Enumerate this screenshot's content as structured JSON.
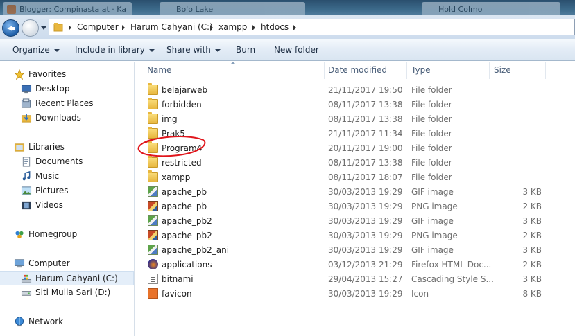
{
  "taskbar": {
    "tabs": [
      {
        "label": "Blogger: Compinasta at · Ka"
      },
      {
        "label": "Bo'o Lake"
      },
      {
        "label": "Hold Colmo"
      }
    ]
  },
  "address": {
    "crumbs": [
      "Computer",
      "Harum Cahyani (C:)",
      "xampp",
      "htdocs"
    ]
  },
  "toolbar": {
    "organize": "Organize",
    "include_in_library": "Include in library",
    "share_with": "Share with",
    "burn": "Burn",
    "new_folder": "New folder"
  },
  "nav": {
    "favorites": "Favorites",
    "desktop": "Desktop",
    "recent_places": "Recent Places",
    "downloads": "Downloads",
    "libraries": "Libraries",
    "documents": "Documents",
    "music": "Music",
    "pictures": "Pictures",
    "videos": "Videos",
    "homegroup": "Homegroup",
    "computer": "Computer",
    "drive_c": "Harum Cahyani (C:)",
    "drive_d": "Siti Mulia Sari (D:)",
    "network": "Network"
  },
  "columns": {
    "name": "Name",
    "date_modified": "Date modified",
    "type": "Type",
    "size": "Size"
  },
  "files": [
    {
      "name": "belajarweb",
      "date": "21/11/2017 19:50",
      "type": "File folder",
      "size": "",
      "icon": "folder-icon"
    },
    {
      "name": "forbidden",
      "date": "08/11/2017 13:38",
      "type": "File folder",
      "size": "",
      "icon": "folder-icon"
    },
    {
      "name": "img",
      "date": "08/11/2017 13:38",
      "type": "File folder",
      "size": "",
      "icon": "folder-icon"
    },
    {
      "name": "Prak5",
      "date": "21/11/2017 11:34",
      "type": "File folder",
      "size": "",
      "icon": "folder-icon"
    },
    {
      "name": "Program4",
      "date": "20/11/2017 19:00",
      "type": "File folder",
      "size": "",
      "icon": "folder-icon"
    },
    {
      "name": "restricted",
      "date": "08/11/2017 13:38",
      "type": "File folder",
      "size": "",
      "icon": "folder-icon"
    },
    {
      "name": "xampp",
      "date": "08/11/2017 18:07",
      "type": "File folder",
      "size": "",
      "icon": "folder-icon"
    },
    {
      "name": "apache_pb",
      "date": "30/03/2013 19:29",
      "type": "GIF image",
      "size": "3 KB",
      "icon": "gif-image-icon"
    },
    {
      "name": "apache_pb",
      "date": "30/03/2013 19:29",
      "type": "PNG image",
      "size": "2 KB",
      "icon": "png-image-icon"
    },
    {
      "name": "apache_pb2",
      "date": "30/03/2013 19:29",
      "type": "GIF image",
      "size": "3 KB",
      "icon": "gif-image-icon"
    },
    {
      "name": "apache_pb2",
      "date": "30/03/2013 19:29",
      "type": "PNG image",
      "size": "2 KB",
      "icon": "png-image-icon"
    },
    {
      "name": "apache_pb2_ani",
      "date": "30/03/2013 19:29",
      "type": "GIF image",
      "size": "3 KB",
      "icon": "gif-image-icon"
    },
    {
      "name": "applications",
      "date": "03/12/2013 21:29",
      "type": "Firefox HTML Doc...",
      "size": "2 KB",
      "icon": "firefox-html-icon"
    },
    {
      "name": "bitnami",
      "date": "29/04/2013 15:27",
      "type": "Cascading Style S...",
      "size": "3 KB",
      "icon": "css-file-icon"
    },
    {
      "name": "favicon",
      "date": "30/03/2013 19:29",
      "type": "Icon",
      "size": "8 KB",
      "icon": "icon-file-icon"
    }
  ],
  "colors": {
    "selection": "#e4eef9",
    "annotation": "#e0151b"
  }
}
